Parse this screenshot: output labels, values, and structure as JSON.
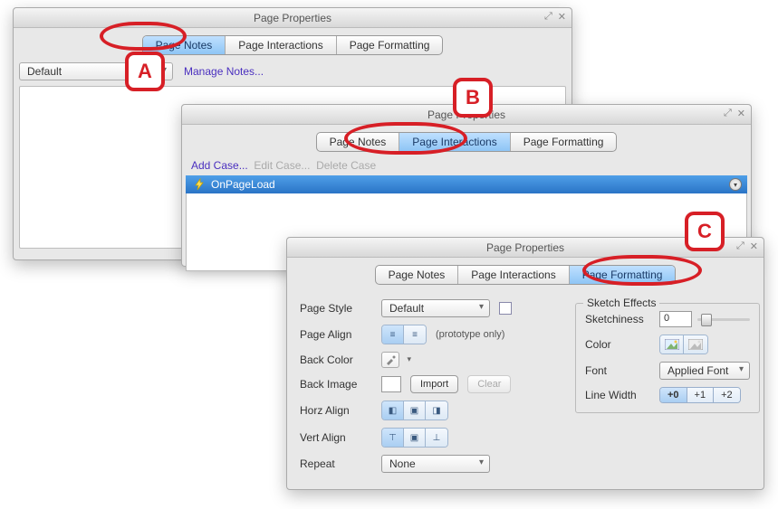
{
  "panelA": {
    "title": "Page Properties",
    "tabs": [
      "Page Notes",
      "Page Interactions",
      "Page Formatting"
    ],
    "noteSelected": "Default",
    "manageNotes": "Manage Notes..."
  },
  "panelB": {
    "title": "Page Properties",
    "tabs": [
      "Page Notes",
      "Page Interactions",
      "Page Formatting"
    ],
    "addCase": "Add Case...",
    "editCase": "Edit Case...",
    "deleteCase": "Delete Case",
    "event": "OnPageLoad"
  },
  "panelC": {
    "title": "Page Properties",
    "tabs": [
      "Page Notes",
      "Page Interactions",
      "Page Formatting"
    ],
    "labels": {
      "pageStyle": "Page Style",
      "pageAlign": "Page Align",
      "backColor": "Back Color",
      "backImage": "Back Image",
      "horzAlign": "Horz Align",
      "vertAlign": "Vert Align",
      "repeat": "Repeat"
    },
    "values": {
      "pageStyle": "Default",
      "prototypeOnly": "(prototype only)",
      "import": "Import",
      "clear": "Clear",
      "repeat": "None"
    },
    "sketch": {
      "legend": "Sketch Effects",
      "sketchiness": "Sketchiness",
      "sketchValue": "0",
      "color": "Color",
      "font": "Font",
      "fontValue": "Applied Font",
      "lineWidth": "Line Width",
      "lw": [
        "+0",
        "+1",
        "+2"
      ]
    }
  },
  "callouts": {
    "A": "A",
    "B": "B",
    "C": "C"
  }
}
